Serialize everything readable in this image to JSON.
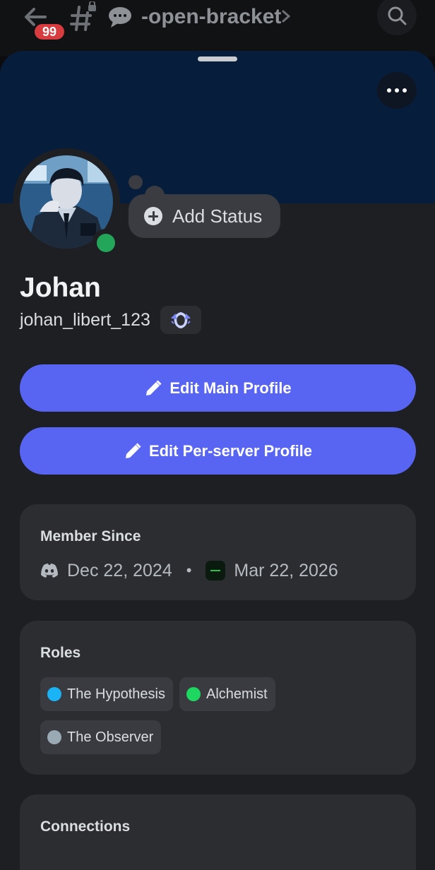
{
  "header": {
    "badge_count": "99",
    "channel_emoji": "speech-balloon",
    "channel_name": "-open-bracket",
    "icons": [
      "back-arrow-icon",
      "locked-hash-icon",
      "chevron-right-icon",
      "search-icon"
    ]
  },
  "profile": {
    "display_name": "Johan",
    "username": "johan_libert_123",
    "status_button_label": "Add Status",
    "online_status_color": "#23a55a",
    "banner_color": "#061d3b"
  },
  "actions": {
    "edit_main_label": "Edit Main Profile",
    "edit_server_label": "Edit Per-server Profile",
    "button_color": "#5865f2"
  },
  "member_since": {
    "title": "Member Since",
    "discord_date": "Dec 22, 2024",
    "separator": "•",
    "server_date": "Mar 22, 2026"
  },
  "roles": {
    "title": "Roles",
    "items": [
      {
        "name": "The Hypothesis",
        "color": "#1ab3f5"
      },
      {
        "name": "Alchemist",
        "color": "#1ed760"
      },
      {
        "name": "The Observer",
        "color": "#99aab5"
      }
    ]
  },
  "connections": {
    "title": "Connections"
  }
}
